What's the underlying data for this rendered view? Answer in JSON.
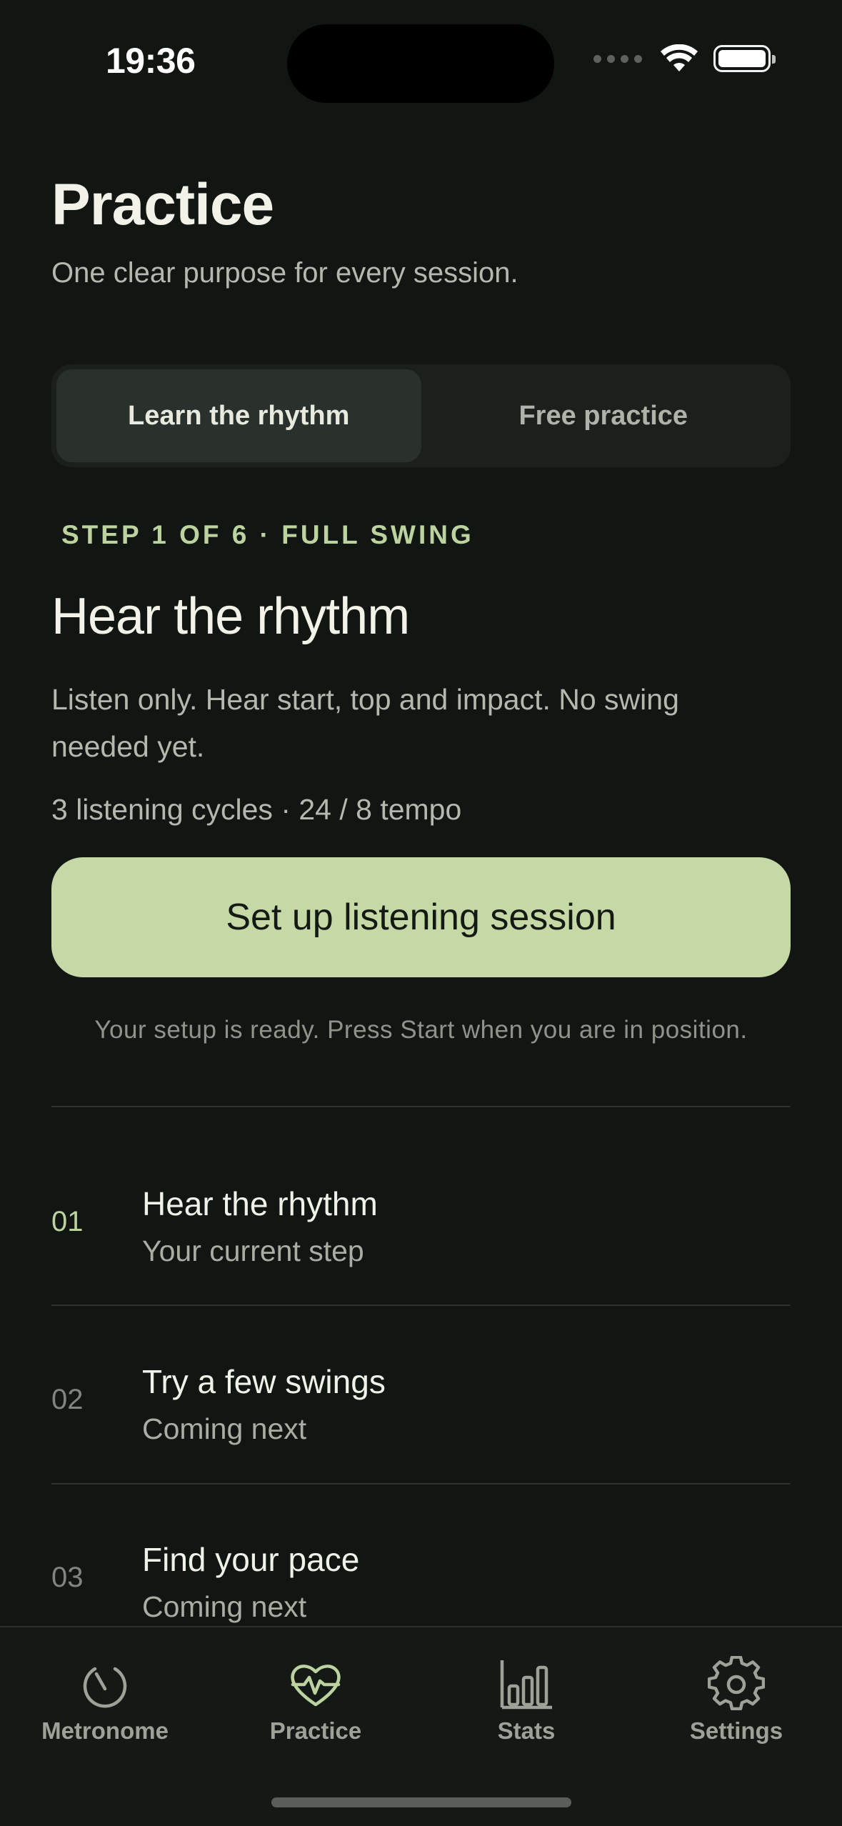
{
  "status_bar": {
    "time": "19:36"
  },
  "header": {
    "title": "Practice",
    "subtitle": "One clear purpose for every session."
  },
  "segments": [
    {
      "label": "Learn the rhythm",
      "selected": true
    },
    {
      "label": "Free practice",
      "selected": false
    }
  ],
  "current_step": {
    "label": "STEP 1 OF 6 · FULL SWING",
    "title": "Hear the rhythm",
    "description": "Listen only. Hear start, top and impact. No swing needed yet.",
    "meta": "3 listening cycles · 24 / 8 tempo",
    "cta_label": "Set up listening session",
    "note": "Your setup is ready. Press Start when you are in position."
  },
  "steps": [
    {
      "number": "01",
      "name": "Hear the rhythm",
      "status": "Your current step"
    },
    {
      "number": "02",
      "name": "Try a few swings",
      "status": "Coming next"
    },
    {
      "number": "03",
      "name": "Find your pace",
      "status": "Coming next"
    }
  ],
  "tabs": [
    {
      "label": "Metronome",
      "icon": "metronome-icon",
      "active": false
    },
    {
      "label": "Practice",
      "icon": "heartbeat-icon",
      "active": true
    },
    {
      "label": "Stats",
      "icon": "bar-chart-icon",
      "active": false
    },
    {
      "label": "Settings",
      "icon": "gear-icon",
      "active": false
    }
  ],
  "colors": {
    "background": "#121613",
    "accent": "#c5d9a6",
    "accent_text": "#bcd3a0",
    "muted_text": "#b5b8ae"
  }
}
